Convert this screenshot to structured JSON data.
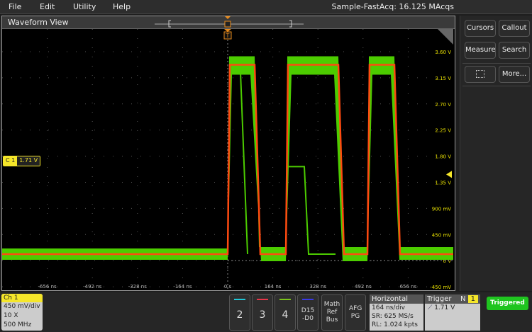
{
  "menu": {
    "items": [
      "File",
      "Edit",
      "Utility",
      "Help"
    ],
    "acquisition_status": "Sample-FastAcq: 16.125 MAcqs"
  },
  "waveform_view": {
    "title": "Waveform View",
    "channel_marker": {
      "label": "C 1",
      "value": "1.71 V"
    },
    "trigger_marker": "T",
    "y_ticks": [
      "3.60 V",
      "3.15 V",
      "2.70 V",
      "2.25 V",
      "1.80 V",
      "1.35 V",
      "900 mV",
      "450 mV",
      "0 V",
      "-450 mV"
    ],
    "x_ticks": [
      "-656 ns",
      "-492 ns",
      "-328 ns",
      "-164 ns",
      "0 s",
      "164 ns",
      "328 ns",
      "492 ns",
      "656 ns"
    ],
    "colors": {
      "waveform_envelope": "#4ccc00",
      "waveform_core": "#ff4a10",
      "axis_labels": "#e8e000",
      "trigger": "#e88a1a"
    }
  },
  "side_panel": {
    "cursors": "Cursors",
    "callout": "Callout",
    "measure": "Measure",
    "search": "Search",
    "zoom_icon": "zoom-box-icon",
    "more": "More..."
  },
  "bottom": {
    "ch1": {
      "title": "Ch 1",
      "scale": "450 mV/div",
      "probe": "10 X",
      "bandwidth": "500 MHz"
    },
    "channels": [
      {
        "label": "2",
        "color": "#21c8d8"
      },
      {
        "label": "3",
        "color": "#e8374a"
      },
      {
        "label": "4",
        "color": "#7cc41c"
      }
    ],
    "digital": "D15 -D0",
    "math": "Math Ref Bus",
    "afg": "AFG PG",
    "horizontal": {
      "title": "Horizontal",
      "scale": "164 ns/div",
      "sample_rate": "SR: 625 MS/s",
      "record_length": "RL: 1.024 kpts"
    },
    "trigger": {
      "title": "Trigger",
      "mode": "N",
      "badge": "1",
      "level": "1.71 V"
    },
    "status": "Triggered"
  }
}
